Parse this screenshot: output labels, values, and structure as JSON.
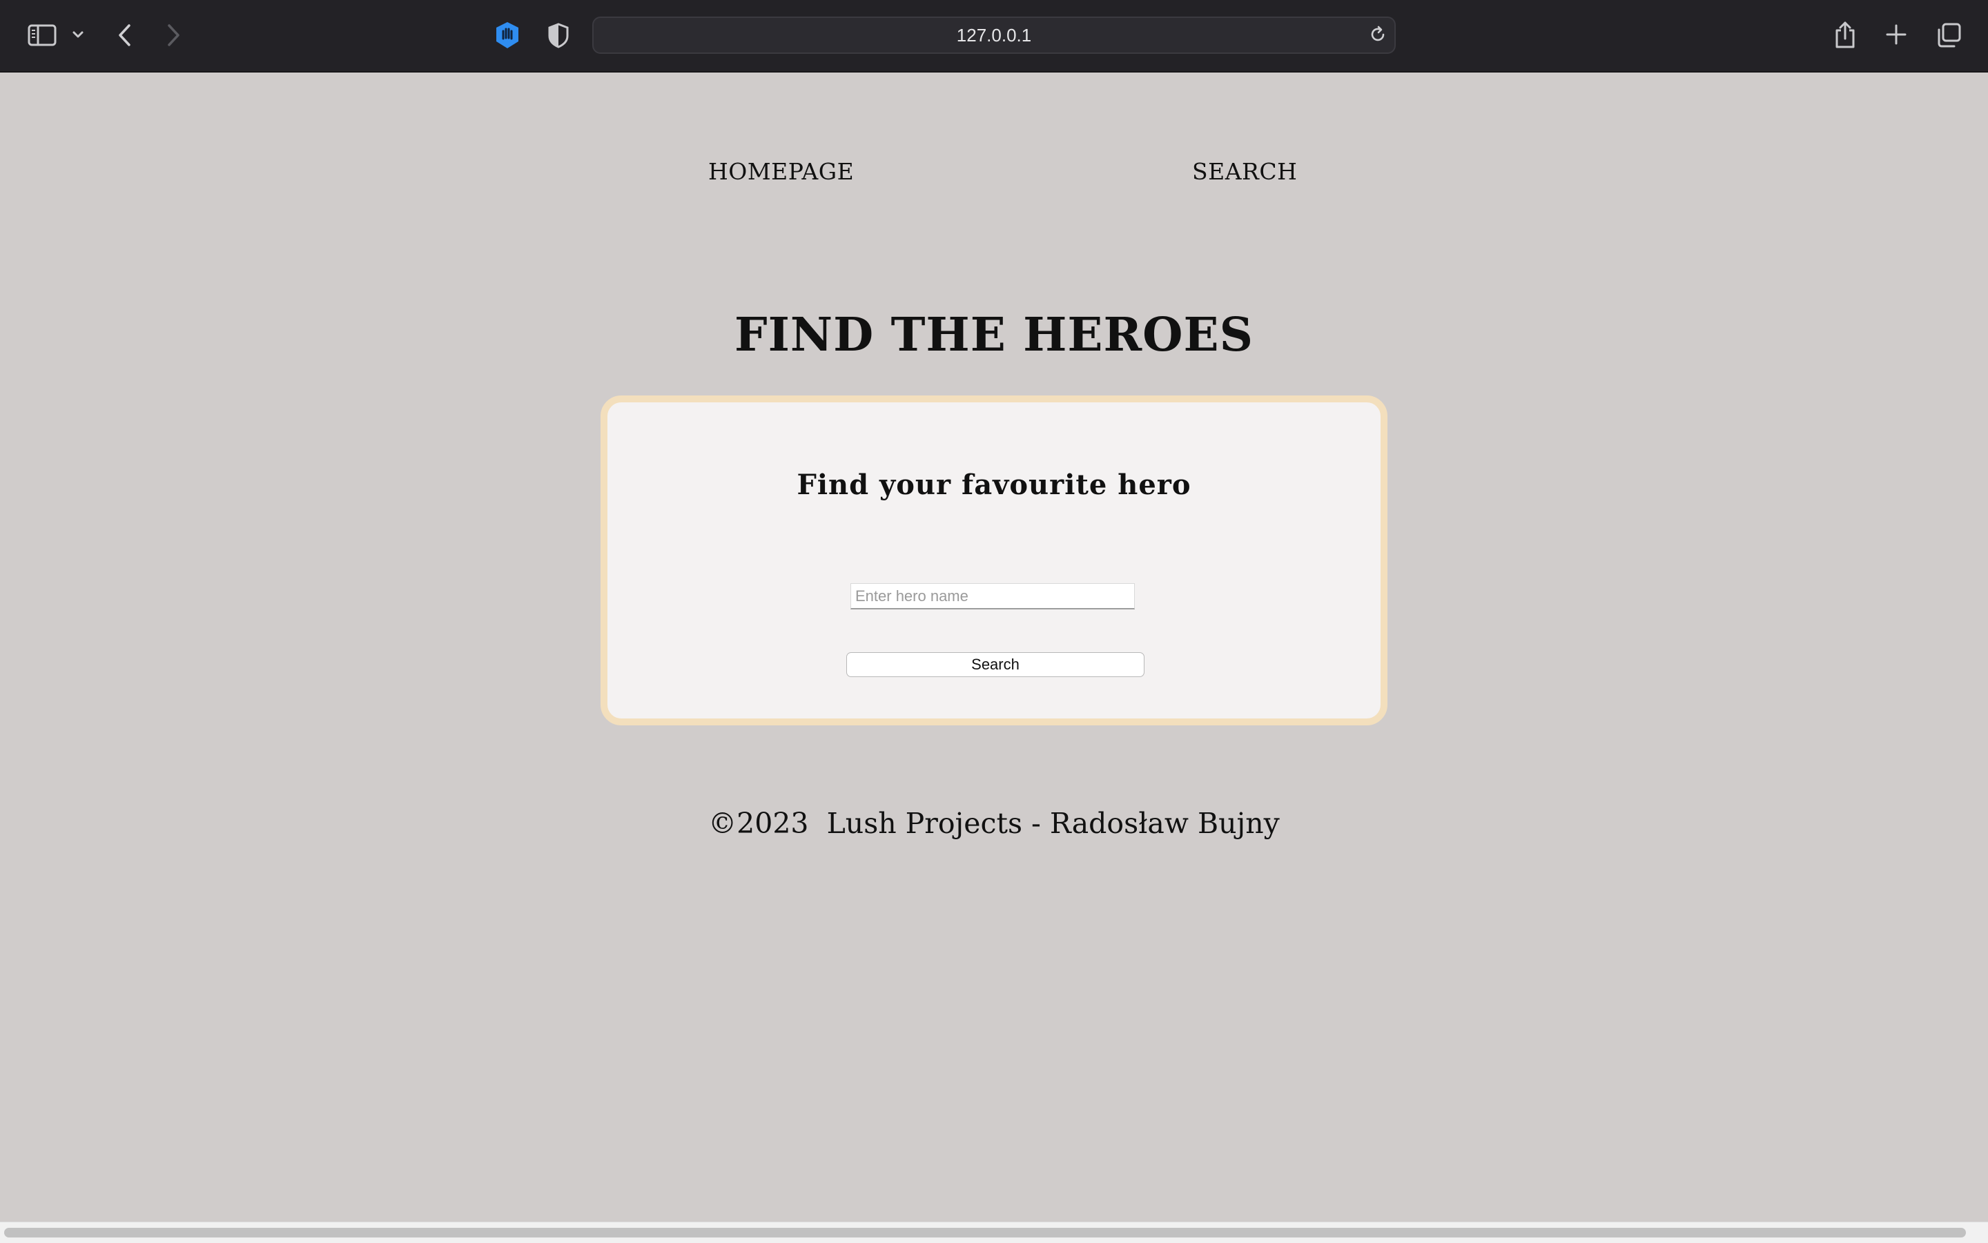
{
  "browser": {
    "url": "127.0.0.1",
    "icons": {
      "sidebar": "sidebar-icon",
      "sidebar_menu": "chevron-down-icon",
      "back": "chevron-left-icon",
      "forward": "chevron-right-icon",
      "privacy": "hand-shield-icon",
      "privacy_report": "half-shield-icon",
      "reload": "reload-icon",
      "share": "share-icon",
      "new_tab": "plus-icon",
      "tab_overview": "tabs-icon"
    },
    "colors": {
      "toolbar": "#232226",
      "privacy_accent": "#2f8df0"
    }
  },
  "nav": {
    "home_label": "HOMEPAGE",
    "search_label": "SEARCH"
  },
  "page": {
    "title": "FIND THE HEROES",
    "background": "#d0cccb"
  },
  "search_card": {
    "heading": "Find your favourite hero",
    "input_value": "",
    "input_placeholder": "Enter hero name",
    "button_label": "Search",
    "border_color": "#f3dfbd",
    "background": "#f4f2f2"
  },
  "footer": {
    "text": "©2023  Lush Projects - Radosław Bujny"
  }
}
